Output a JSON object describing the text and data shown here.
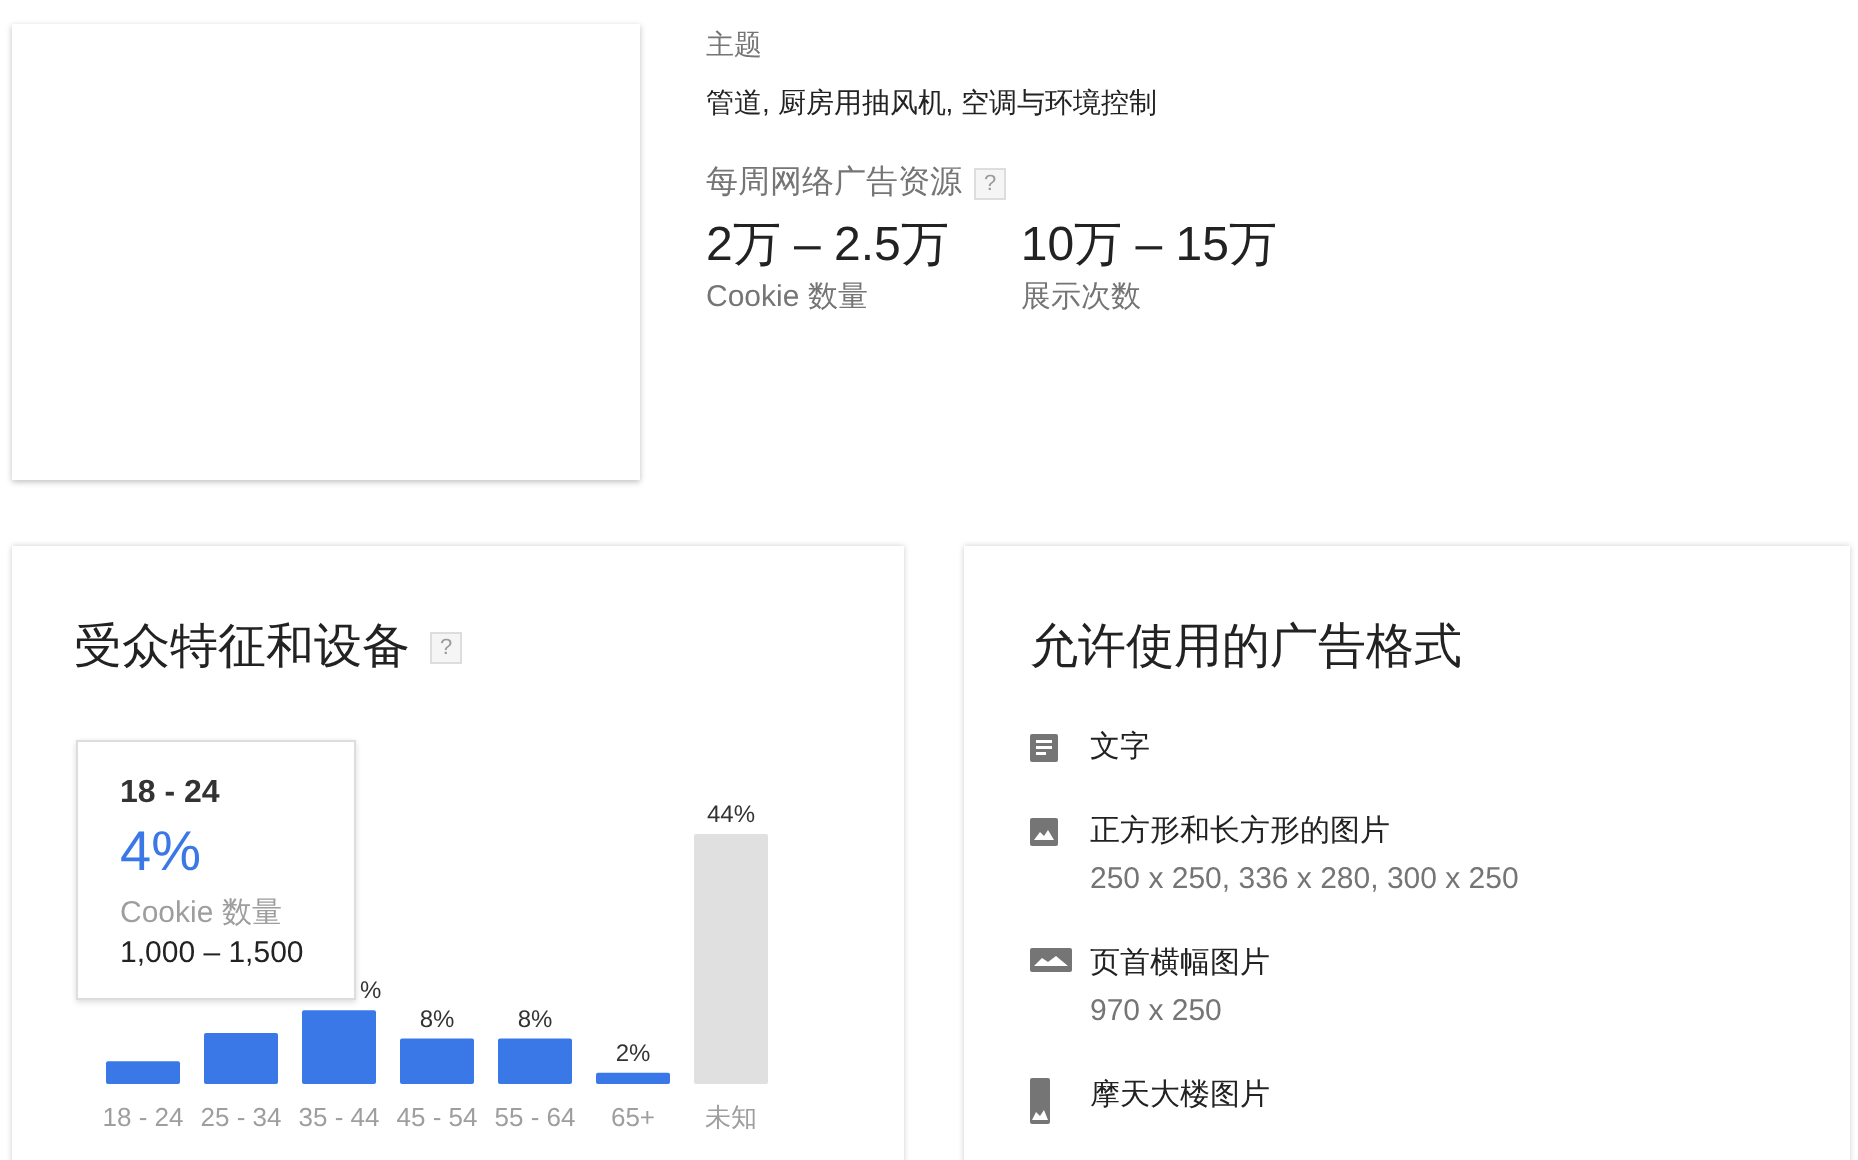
{
  "topic": {
    "label": "主题",
    "value": "管道, 厨房用抽风机, 空调与环境控制"
  },
  "weekly_inventory": {
    "label": "每周网络广告资源",
    "help": "?",
    "stats": [
      {
        "value": "2万 – 2.5万",
        "label": "Cookie 数量"
      },
      {
        "value": "10万 – 15万",
        "label": "展示次数"
      }
    ]
  },
  "demographics": {
    "title": "受众特征和设备",
    "help": "?",
    "chart_data": {
      "type": "bar",
      "categories": [
        "18 - 24",
        "25 - 34",
        "35 - 44",
        "45 - 54",
        "55 - 64",
        "65+",
        "未知"
      ],
      "values": [
        4,
        9,
        13,
        8,
        8,
        2,
        44
      ],
      "colors": [
        "#3b78e7",
        "#3b78e7",
        "#3b78e7",
        "#3b78e7",
        "#3b78e7",
        "#3b78e7",
        "#e0e0e0"
      ],
      "value_labels": [
        null,
        null,
        "%",
        "8%",
        "8%",
        "2%",
        "44%"
      ]
    },
    "tooltip": {
      "title": "18 - 24",
      "value": "4%",
      "label": "Cookie 数量",
      "range": "1,000 – 1,500"
    }
  },
  "ad_formats": {
    "title": "允许使用的广告格式",
    "items": [
      {
        "kind": "text",
        "name": "文字"
      },
      {
        "kind": "image",
        "name": "正方形和长方形的图片",
        "sizes": "250 x 250, 336 x 280, 300 x 250"
      },
      {
        "kind": "banner",
        "name": "页首横幅图片",
        "sizes": "970 x 250"
      },
      {
        "kind": "skyscraper",
        "name": "摩天大楼图片"
      }
    ]
  }
}
